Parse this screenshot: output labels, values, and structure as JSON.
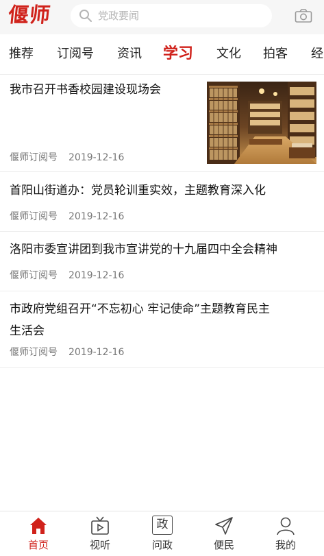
{
  "header": {
    "logo_text": "偃师",
    "search_placeholder": "党政要闻"
  },
  "tabs": [
    {
      "label": "推荐"
    },
    {
      "label": "订阅号"
    },
    {
      "label": "资讯"
    },
    {
      "label": "学习",
      "active": true
    },
    {
      "label": "文化"
    },
    {
      "label": "拍客"
    },
    {
      "label": "经"
    }
  ],
  "articles": [
    {
      "title": "我市召开书香校园建设现场会",
      "source": "偃师订阅号",
      "date": "2019-12-16",
      "has_image": true
    },
    {
      "title": "首阳山街道办：党员轮训重实效，主题教育深入化",
      "source": "偃师订阅号",
      "date": "2019-12-16"
    },
    {
      "title": "洛阳市委宣讲团到我市宣讲党的十九届四中全会精神",
      "source": "偃师订阅号",
      "date": "2019-12-16"
    },
    {
      "title_line1": "市政府党组召开“不忘初心 牢记使命”主题教育民主",
      "title_line2": "生活会",
      "source": "偃师订阅号",
      "date": "2019-12-16"
    }
  ],
  "bottom_nav": [
    {
      "label": "首页",
      "icon": "home-icon",
      "active": true
    },
    {
      "label": "视听",
      "icon": "tv-icon"
    },
    {
      "label": "问政",
      "icon": "wenzheng-icon",
      "icon_text": "政"
    },
    {
      "label": "便民",
      "icon": "send-icon"
    },
    {
      "label": "我的",
      "icon": "user-icon"
    }
  ],
  "colors": {
    "accent": "#d0221b",
    "header_bg": "#f6f6f6",
    "meta_text": "#777777"
  }
}
